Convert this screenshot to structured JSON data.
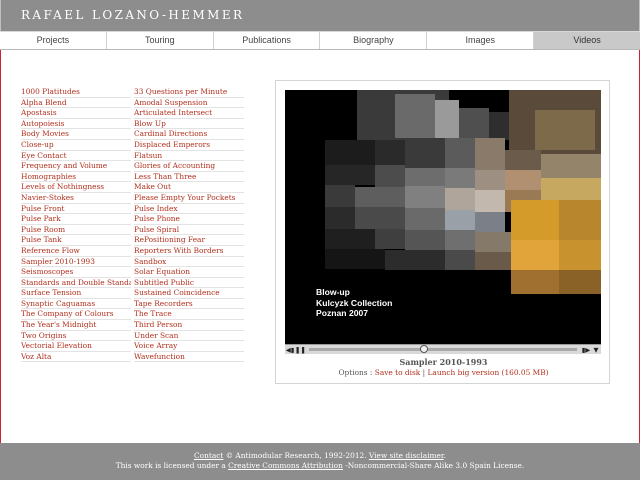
{
  "site": {
    "title": "RAFAEL LOZANO-HEMMER"
  },
  "nav": {
    "tabs": [
      {
        "label": "Projects",
        "active": false
      },
      {
        "label": "Touring",
        "active": false
      },
      {
        "label": "Publications",
        "active": false
      },
      {
        "label": "Biography",
        "active": false
      },
      {
        "label": "Images",
        "active": false
      },
      {
        "label": "Videos",
        "active": true
      }
    ]
  },
  "list": {
    "left": [
      "1000 Platitudes",
      "Alpha Blend",
      "Apostasis",
      "Autopoiesis",
      "Body Movies",
      "Close-up",
      "Eye Contact",
      "Frequency and Volume",
      "Homographies",
      "Levels of Nothingness",
      "Navier-Stokes",
      "Pulse Front",
      "Pulse Park",
      "Pulse Room",
      "Pulse Tank",
      "Reference Flow",
      "Sampler 2010-1993",
      "Seismoscopes",
      "Standards and Double Standards",
      "Surface Tension",
      "Synaptic Caguamas",
      "The Company of Colours",
      "The Year's Midnight",
      "Two Origins",
      "Vectorial Elevation",
      "Voz Alta"
    ],
    "right": [
      "33 Questions per Minute",
      "Amodal Suspension",
      "Articulated Intersect",
      "Blow Up",
      "Cardinal Directions",
      "Displaced Emperors",
      "Flatsun",
      "Glories of Accounting",
      "Less Than Three",
      "Make Out",
      "Please Empty Your Pockets",
      "Pulse Index",
      "Pulse Phone",
      "Pulse Spiral",
      "RePositioning Fear",
      "Reporters With Borders",
      "Sandbox",
      "Solar Equation",
      "Subtitled Public",
      "Sustained Coincidence",
      "Tape Recorders",
      "The Trace",
      "Third Person",
      "Under Scan",
      "Voice Array",
      "Wavefunction"
    ]
  },
  "player": {
    "overlay_lines": [
      "Blow-up",
      "Kulcyzk Collection",
      "Poznan 2007"
    ],
    "progress": 0.43,
    "title": "Sampler 2010-1993",
    "options_prefix": "Options : ",
    "save_label": "Save to disk",
    "separator": " | ",
    "launch_label": "Launch big version (160.05 MB)",
    "icons": {
      "rewind": "rewind-icon",
      "pause": "pause-icon",
      "forward": "fast-forward-icon",
      "volume": "volume-icon"
    }
  },
  "footer": {
    "contact_label": "Contact",
    "copyright": " © Antimodular Research, 1992-2012. ",
    "disclaimer_label": "View site disclaimer",
    "end1": ".",
    "line2_prefix": "This work is licensed under a ",
    "cc_label": "Creative Commons Attribution",
    "line2_suffix": " -Noncommercial-Share Alike 3.0 Spain License."
  },
  "colors": {
    "accent_link": "#b0301e",
    "header_bg": "#8d8d8d",
    "frame_border": "#cc2233"
  }
}
